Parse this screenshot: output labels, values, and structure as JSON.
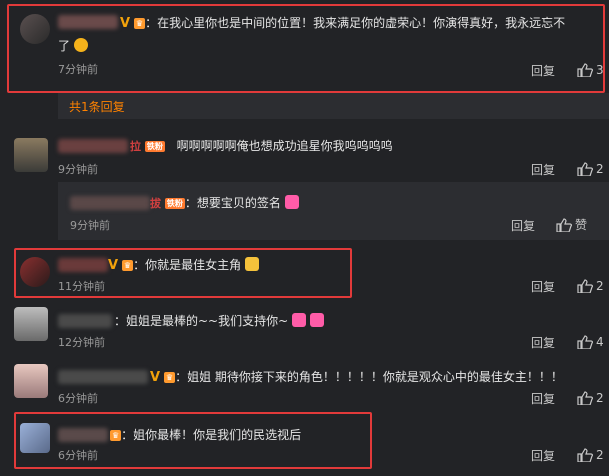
{
  "c1": {
    "text1": "：在我心里你也是中间的位置！我来满足你的虚荣心！你演得真好，我永远忘不",
    "text2": "了",
    "time": "7分钟前",
    "reply": "回复",
    "likes": "3"
  },
  "expand": {
    "label": "共1条回复"
  },
  "c2": {
    "text": "啊啊啊啊啊俺也想成功追星你我呜呜呜呜",
    "time": "9分钟前",
    "reply": "回复",
    "likes": "2",
    "badge": "铁粉"
  },
  "c2sub": {
    "text": "：想要宝贝的签名",
    "time": "9分钟前",
    "reply": "回复",
    "likes": "赞",
    "badge": "铁粉"
  },
  "c3": {
    "text": "：你就是最佳女主角",
    "time": "11分钟前",
    "reply": "回复",
    "likes": "2",
    "vip": "V"
  },
  "c4": {
    "text": "：姐姐是最棒的~~我们支持你~",
    "time": "12分钟前",
    "reply": "回复",
    "likes": "4"
  },
  "c5": {
    "text": "：姐姐 期待你接下来的角色！！！！！你就是观众心中的最佳女主！！！",
    "time": "6分钟前",
    "reply": "回复",
    "likes": "2",
    "vip": "V"
  },
  "c6": {
    "text": "：姐你最棒！你是我们的民选视后",
    "time": "6分钟前",
    "reply": "回复",
    "likes": "2"
  },
  "colors": {
    "accent": "#ff8200",
    "highlight": "#e23a3a",
    "background": "#222326"
  }
}
